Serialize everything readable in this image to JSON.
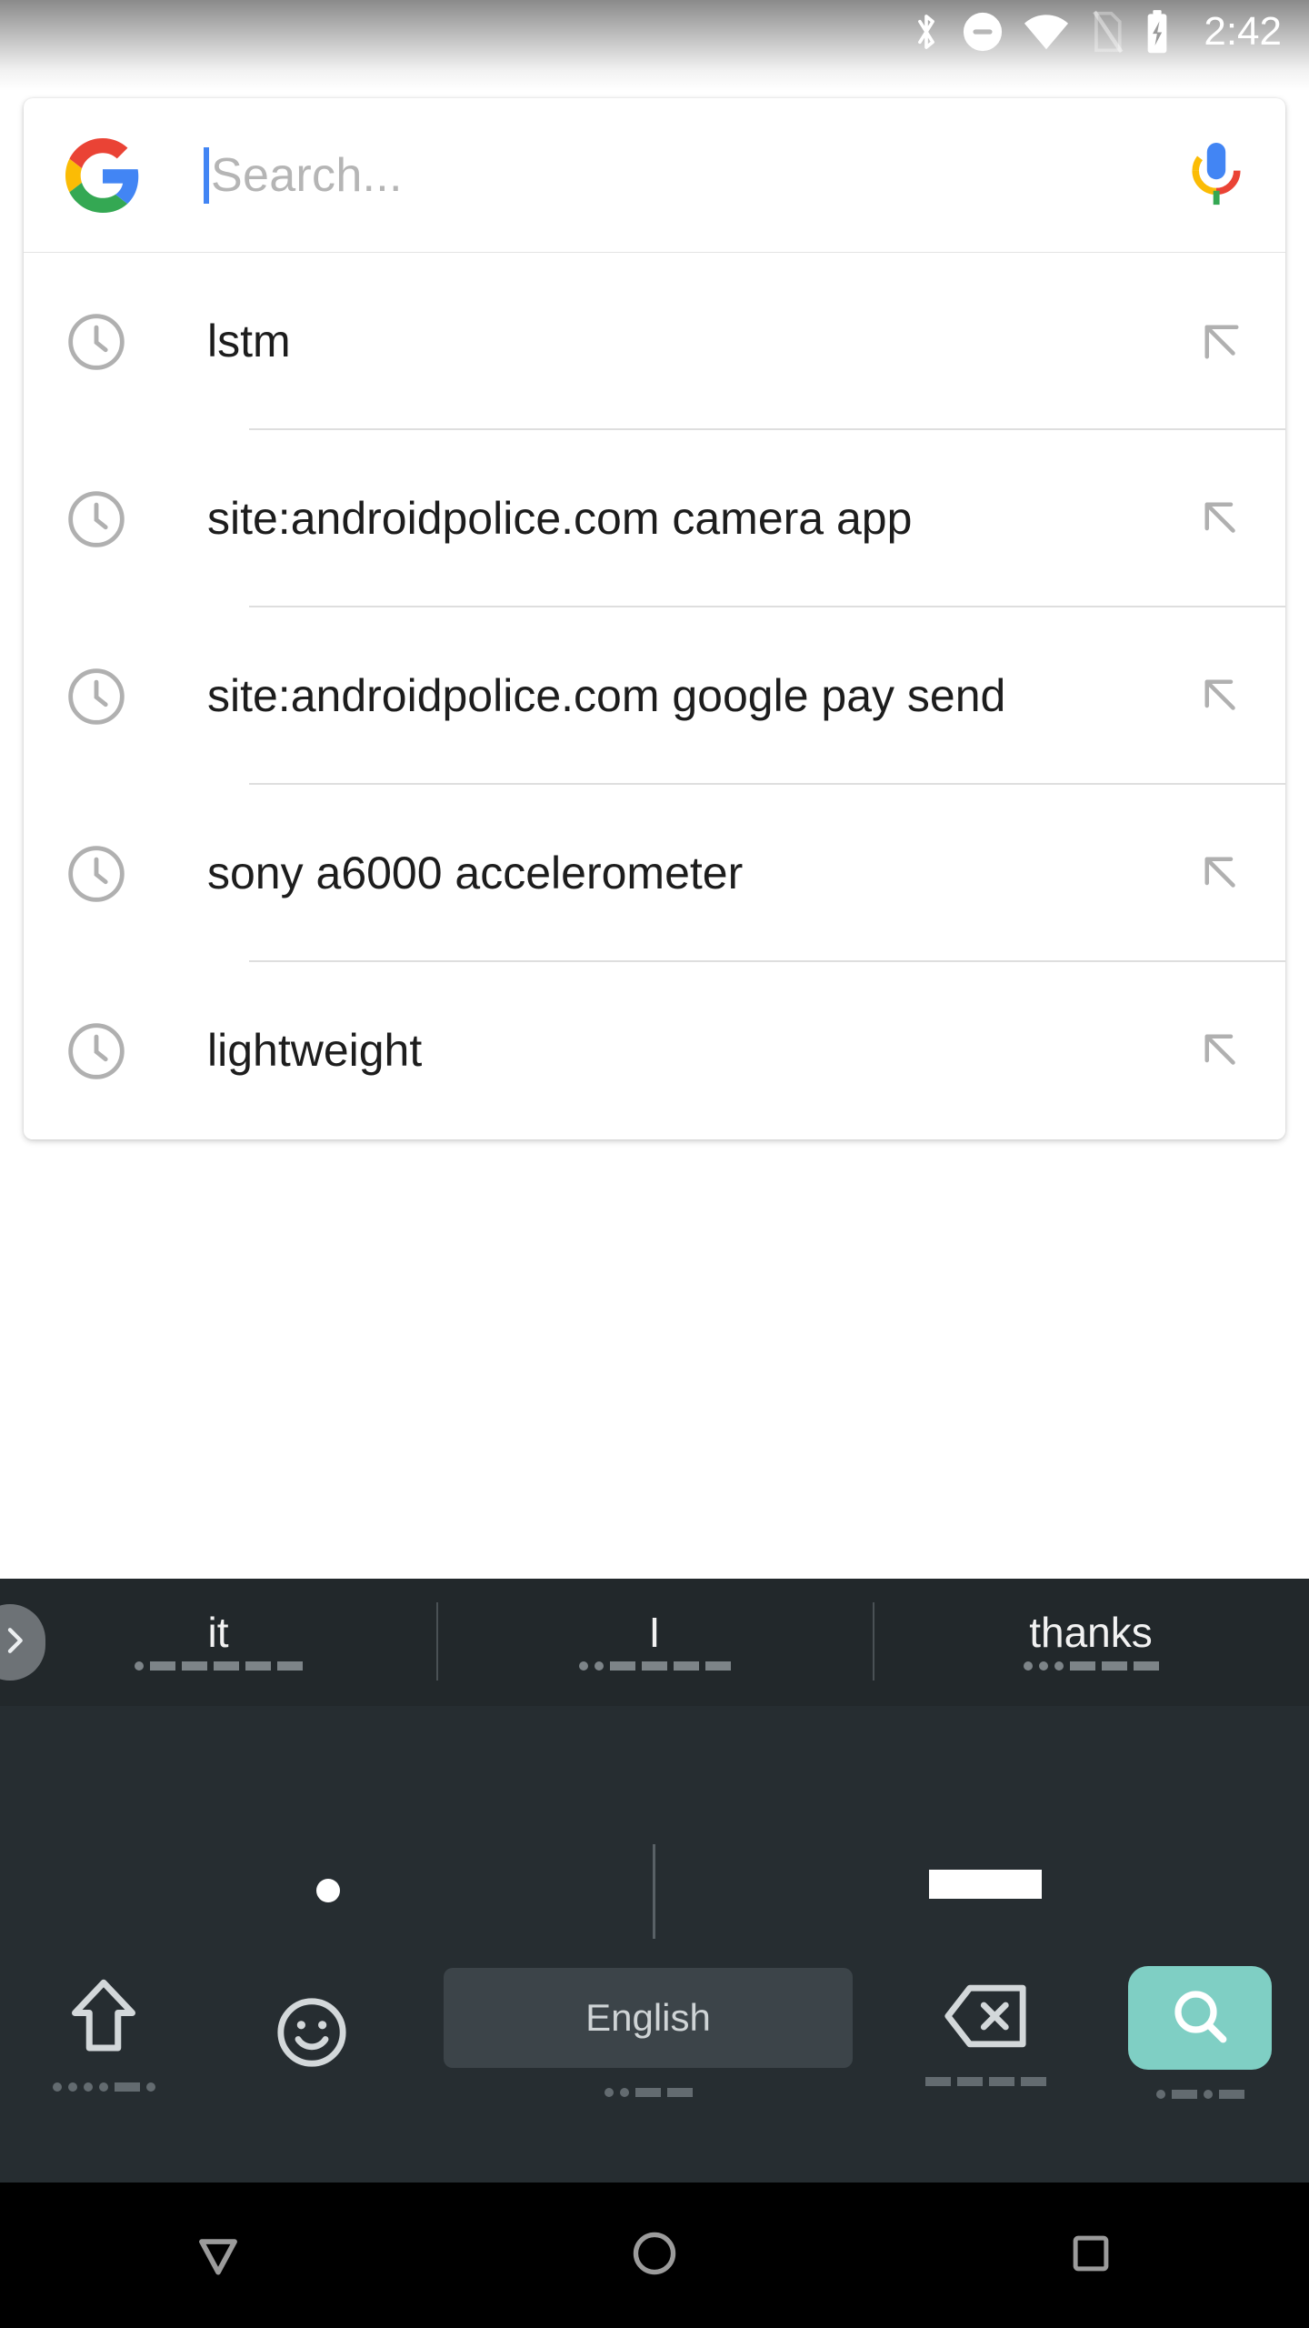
{
  "status_bar": {
    "time": "2:42",
    "icons": [
      {
        "name": "bluetooth-icon"
      },
      {
        "name": "do-not-disturb-icon"
      },
      {
        "name": "wifi-icon"
      },
      {
        "name": "no-sim-icon"
      },
      {
        "name": "battery-charging-icon"
      }
    ]
  },
  "search": {
    "logo": "google-g-logo",
    "placeholder": "Search...",
    "value": "",
    "mic_icon": "google-mic-icon"
  },
  "suggestions": [
    {
      "icon": "history-clock-icon",
      "text": "lstm",
      "action_icon": "arrow-up-left-icon"
    },
    {
      "icon": "history-clock-icon",
      "text": "site:androidpolice.com camera app",
      "action_icon": "arrow-up-left-icon"
    },
    {
      "icon": "history-clock-icon",
      "text": "site:androidpolice.com google pay send",
      "action_icon": "arrow-up-left-icon"
    },
    {
      "icon": "history-clock-icon",
      "text": "sony a6000 accelerometer",
      "action_icon": "arrow-up-left-icon"
    },
    {
      "icon": "history-clock-icon",
      "text": "lightweight",
      "action_icon": "arrow-up-left-icon"
    }
  ],
  "keyboard": {
    "expand_icon": "chevron-right-icon",
    "suggestion_strip": [
      {
        "word": "it",
        "marks": [
          "dot",
          "dash",
          "dash",
          "dash",
          "dash",
          "dash"
        ]
      },
      {
        "word": "I",
        "marks": [
          "dot",
          "dot",
          "dash",
          "dash",
          "dash",
          "dash"
        ]
      },
      {
        "word": "thanks",
        "marks": [
          "dot",
          "dot",
          "dot",
          "dash",
          "dash",
          "dash"
        ]
      }
    ],
    "keys": [
      {
        "name": "shift-key",
        "icon": "shift-arrow-icon",
        "label": "",
        "marks": [
          "dot",
          "dot",
          "dot",
          "dot",
          "dash",
          "dot"
        ]
      },
      {
        "name": "emoji-key",
        "icon": "emoji-smiley-icon",
        "label": "",
        "marks": []
      },
      {
        "name": "space-key",
        "icon": "",
        "label": "English",
        "marks": [
          "dot",
          "dot",
          "dash",
          "dash"
        ]
      },
      {
        "name": "backspace-key",
        "icon": "backspace-icon",
        "label": "",
        "marks": [
          "dash",
          "dash",
          "dash",
          "dash"
        ]
      },
      {
        "name": "search-key",
        "icon": "search-magnifier-icon",
        "label": "",
        "marks": [
          "dot",
          "dash",
          "dot",
          "dash"
        ]
      }
    ],
    "accent_color": "#7fcfc4",
    "background_color": "#262d31",
    "strip_background_color": "#22282b"
  },
  "nav_bar": [
    {
      "name": "back-button",
      "icon": "triangle-down-icon"
    },
    {
      "name": "home-button",
      "icon": "circle-icon"
    },
    {
      "name": "recents-button",
      "icon": "square-icon"
    }
  ]
}
